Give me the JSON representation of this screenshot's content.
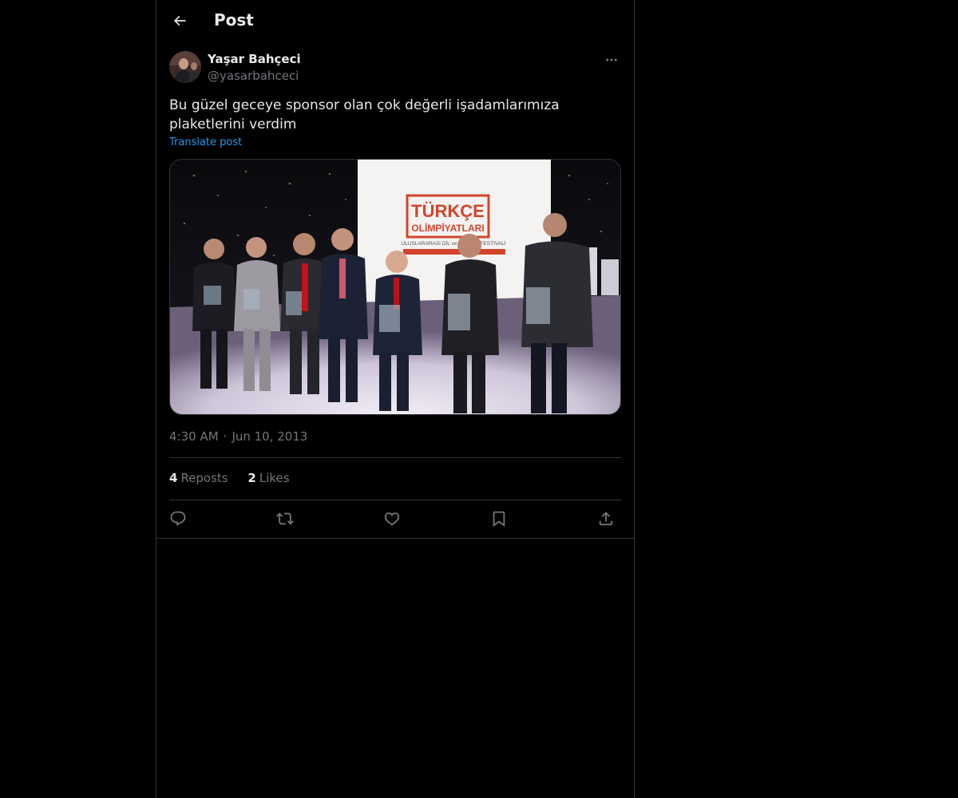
{
  "header": {
    "back_icon": "arrow-left-icon",
    "title": "Post"
  },
  "author": {
    "name": "Yaşar Bahçeci",
    "handle": "@yasarbahceci",
    "more_icon": "more-horizontal-icon"
  },
  "post": {
    "text": "Bu güzel geceye sponsor olan çok değerli işadamlarımıza plaketlerini verdim",
    "translate_label": "Translate post",
    "time": "4:30 AM",
    "separator": "·",
    "date": "Jun 10, 2013"
  },
  "media": {
    "banner_line1": "TÜRKÇE",
    "banner_line2": "OLİMPİYATLARI",
    "banner_sub": "ULUSLARARASI DİL ve KÜLTÜR FESTİVALİ"
  },
  "stats": {
    "reposts_count": "4",
    "reposts_label": "Reposts",
    "likes_count": "2",
    "likes_label": "Likes"
  },
  "actions": {
    "reply_icon": "reply-icon",
    "repost_icon": "repost-icon",
    "like_icon": "heart-icon",
    "bookmark_icon": "bookmark-icon",
    "share_icon": "share-icon"
  },
  "colors": {
    "background": "#000000",
    "text_primary": "#e7e9ea",
    "text_secondary": "#71767b",
    "link": "#1d9bf0",
    "border": "#2f3336"
  }
}
